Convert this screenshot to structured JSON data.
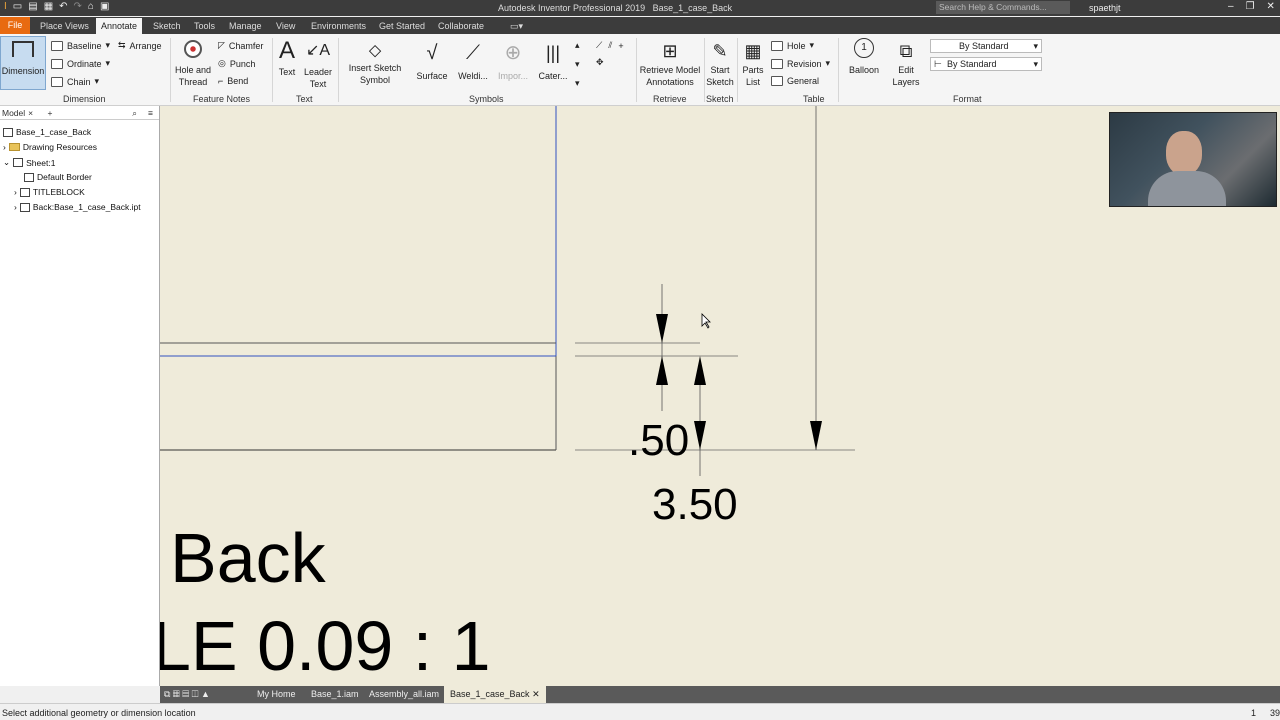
{
  "app": {
    "title": "Autodesk Inventor Professional 2019",
    "document": "Base_1_case_Back",
    "search_placeholder": "Search Help & Commands...",
    "user": "spaethjt"
  },
  "menu_tabs": [
    "File",
    "Place Views",
    "Annotate",
    "Sketch",
    "Tools",
    "Manage",
    "View",
    "Environments",
    "Get Started",
    "Collaborate"
  ],
  "ribbon": {
    "dimension": {
      "main": "Dimension",
      "baseline": "Baseline",
      "ordinate": "Ordinate",
      "chain": "Chain",
      "arrange": "Arrange",
      "title": "Dimension"
    },
    "feature_notes": {
      "hole_thread": "Hole and Thread",
      "chamfer": "Chamfer",
      "punch": "Punch",
      "bend": "Bend",
      "title": "Feature Notes"
    },
    "text": {
      "text": "Text",
      "leader_text": "Leader Text",
      "title": "Text"
    },
    "symbols": {
      "insert_sketch_symbol": "Insert Sketch Symbol",
      "surface": "Surface",
      "welding": "Weldi...",
      "import": "Impor...",
      "caterpillar": "Cater...",
      "title": "Symbols"
    },
    "retrieve": {
      "retrieve_model_annotations": "Retrieve Model Annotations",
      "title": "Retrieve"
    },
    "sketch": {
      "start_sketch": "Start Sketch",
      "title": "Sketch"
    },
    "table": {
      "parts_list": "Parts List",
      "hole": "Hole",
      "revision": "Revision",
      "general": "General",
      "title": "Table"
    },
    "balloon": {
      "balloon": "Balloon"
    },
    "edit_layers": {
      "label": "Edit Layers"
    },
    "format": {
      "style1": "By Standard",
      "style2": "By Standard",
      "title": "Format"
    }
  },
  "browser": {
    "tab": "Model",
    "items": [
      "Base_1_case_Back",
      "Drawing Resources",
      "Sheet:1",
      "Default Border",
      "TITLEBLOCK",
      "Back:Base_1_case_Back.ipt"
    ]
  },
  "drawing": {
    "dim_small": ".50",
    "dim_large": "3.50",
    "view_label": "Back",
    "scale_label": "LE 0.09 : 1"
  },
  "doc_tabs": [
    "My Home",
    "Base_1.iam",
    "Assembly_all.iam",
    "Base_1_case_Back"
  ],
  "status": {
    "message": "Select additional geometry or dimension location",
    "num1": "1",
    "num2": "39"
  }
}
